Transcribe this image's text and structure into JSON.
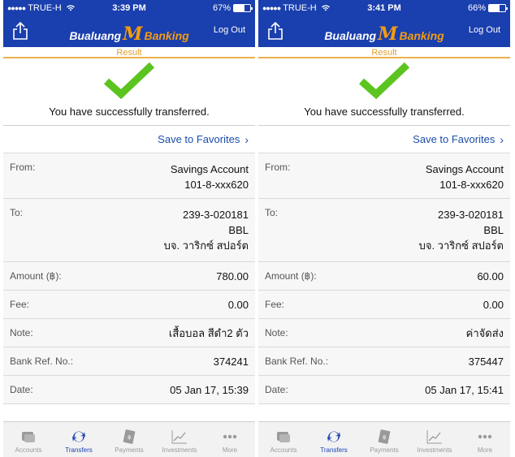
{
  "screens": [
    {
      "status": {
        "carrier": "TRUE-H",
        "time": "3:39 PM",
        "battery": "67%",
        "battery_level": 0.67
      },
      "header": {
        "logo_left": "Bualuang",
        "logo_m": "M",
        "logo_right": "Banking",
        "logout": "Log Out"
      },
      "result_tab": "Result",
      "message": "You have successfully transferred.",
      "save_favorites": "Save to Favorites",
      "from": {
        "label": "From:",
        "line1": "Savings Account",
        "line2": "101-8-xxx620"
      },
      "to": {
        "label": "To:",
        "line1": "239-3-020181",
        "line2": "BBL",
        "line3": "บจ. วาริกซ์ สปอร์ต"
      },
      "amount": {
        "label": "Amount (฿):",
        "value": "780.00"
      },
      "fee": {
        "label": "Fee:",
        "value": "0.00"
      },
      "note": {
        "label": "Note:",
        "value": "เสื้อบอล สีดำ2 ตัว"
      },
      "bank_ref": {
        "label": "Bank Ref. No.:",
        "value": "374241"
      },
      "date": {
        "label": "Date:",
        "value": "05 Jan 17, 15:39"
      },
      "tabs": {
        "accounts": "Accounts",
        "transfers": "Transfers",
        "payments": "Payments",
        "investments": "Investments",
        "more": "More"
      }
    },
    {
      "status": {
        "carrier": "TRUE-H",
        "time": "3:41 PM",
        "battery": "66%",
        "battery_level": 0.66
      },
      "header": {
        "logo_left": "Bualuang",
        "logo_m": "M",
        "logo_right": "Banking",
        "logout": "Log Out"
      },
      "result_tab": "Result",
      "message": "You have successfully transferred.",
      "save_favorites": "Save to Favorites",
      "from": {
        "label": "From:",
        "line1": "Savings Account",
        "line2": "101-8-xxx620"
      },
      "to": {
        "label": "To:",
        "line1": "239-3-020181",
        "line2": "BBL",
        "line3": "บจ. วาริกซ์ สปอร์ต"
      },
      "amount": {
        "label": "Amount (฿):",
        "value": "60.00"
      },
      "fee": {
        "label": "Fee:",
        "value": "0.00"
      },
      "note": {
        "label": "Note:",
        "value": "ค่าจัดส่ง"
      },
      "bank_ref": {
        "label": "Bank Ref. No.:",
        "value": "375447"
      },
      "date": {
        "label": "Date:",
        "value": "05 Jan 17, 15:41"
      },
      "tabs": {
        "accounts": "Accounts",
        "transfers": "Transfers",
        "payments": "Payments",
        "investments": "Investments",
        "more": "More"
      }
    }
  ],
  "colors": {
    "header_bg": "#1a3fae",
    "accent_orange": "#f39c12",
    "check_green": "#5cc41f",
    "link_blue": "#1a4ea8"
  },
  "icons": [
    "share-icon",
    "wifi-icon",
    "battery-icon",
    "checkmark-icon",
    "chevron-right-icon",
    "accounts-icon",
    "transfers-icon",
    "payments-icon",
    "investments-icon",
    "more-icon"
  ]
}
